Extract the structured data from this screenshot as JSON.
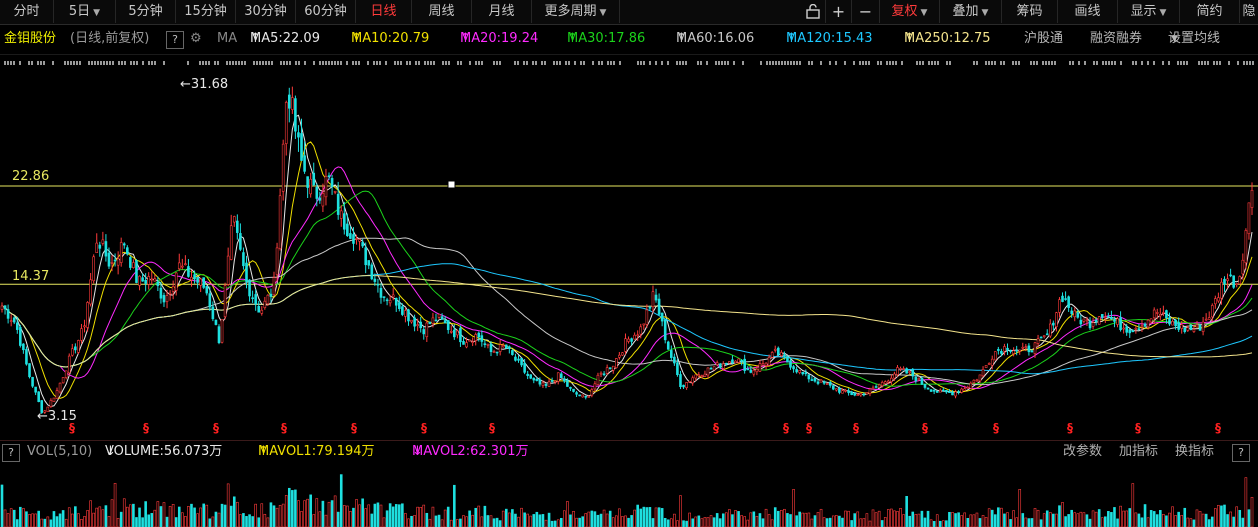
{
  "toolbar": {
    "periods": [
      "分时",
      "5日",
      "5分钟",
      "15分钟",
      "30分钟",
      "60分钟",
      "日线",
      "周线",
      "月线",
      "更多周期"
    ],
    "active_period": "日线",
    "tools": [
      "复权",
      "叠加",
      "筹码",
      "画线",
      "显示",
      "简约",
      "隐"
    ],
    "active_tool": "复权"
  },
  "ma_bar": {
    "stock_name": "金钼股份",
    "mode": "(日线,前复权)",
    "help": "?",
    "ma_label": "MA",
    "ma": [
      {
        "label": "MA5:22.09",
        "arrow": "↑",
        "color": "#e8e8e8"
      },
      {
        "label": "MA10:20.79",
        "arrow": "↑",
        "color": "#f0e000"
      },
      {
        "label": "MA20:19.24",
        "arrow": "↑",
        "color": "#ff2bff"
      },
      {
        "label": "MA30:17.86",
        "arrow": "↑",
        "color": "#1bd21b"
      },
      {
        "label": "MA60:16.06",
        "arrow": "↑",
        "color": "#c8c8c8"
      },
      {
        "label": "MA120:15.43",
        "arrow": "↑",
        "color": "#1ec8ff"
      },
      {
        "label": "MA250:12.75",
        "arrow": "↑",
        "color": "#f4e48c"
      }
    ],
    "links": [
      "沪股通",
      "融资融券",
      "设置均线"
    ]
  },
  "price_labels": {
    "high": "31.68",
    "low": "3.15",
    "line1": "22.86",
    "line2": "14.37"
  },
  "volume_bar": {
    "help": "?",
    "label": "VOL(5,10)",
    "volume": "VOLUME:56.073万",
    "volume_arrow": "↓",
    "mavol1": "MAVOL1:79.194万",
    "mavol1_arrow": "↑",
    "mavol2": "MAVOL2:62.301万",
    "mavol2_arrow": "↓",
    "actions": [
      "改参数",
      "加指标",
      "换指标"
    ]
  },
  "colors": {
    "up": "#ff3b3b",
    "down": "#1ee0e0",
    "ma5": "#e8e8e8",
    "ma10": "#f0e000",
    "ma20": "#ff2bff",
    "ma30": "#1bd21b",
    "ma60": "#c8c8c8",
    "ma120": "#1ec8ff",
    "ma250": "#f4e48c",
    "hline": "#e8e860"
  },
  "chart_data": {
    "type": "candlestick",
    "price_range": [
      3.15,
      31.68
    ],
    "horizontal_lines": [
      22.86,
      14.37
    ],
    "key_points": [
      {
        "label": "low",
        "value": 3.15
      },
      {
        "label": "high",
        "value": 31.68
      }
    ],
    "price_path_estimate": [
      12.5,
      11.0,
      6.5,
      3.15,
      5.0,
      8.0,
      10.5,
      18.5,
      16.0,
      18.0,
      14.5,
      15.0,
      13.0,
      16.0,
      15.0,
      14.0,
      9.5,
      20.0,
      14.5,
      12.0,
      14.0,
      31.68,
      25.0,
      22.0,
      23.5,
      20.0,
      18.5,
      16.0,
      13.5,
      13.0,
      11.5,
      10.5,
      11.5,
      10.5,
      9.5,
      10.0,
      8.5,
      9.0,
      7.5,
      6.0,
      5.5,
      6.5,
      5.0,
      4.5,
      6.5,
      7.5,
      9.5,
      10.5,
      13.5,
      9.0,
      5.5,
      6.5,
      7.0,
      7.5,
      8.0,
      6.8,
      7.5,
      8.5,
      7.5,
      6.5,
      6.0,
      5.5,
      5.0,
      4.8,
      5.2,
      6.0,
      7.0,
      6.5,
      5.5,
      5.0,
      5.0,
      5.5,
      6.5,
      8.5,
      9.0,
      8.5,
      9.0,
      10.0,
      13.5,
      11.5,
      11.0,
      12.0,
      11.0,
      10.5,
      11.0,
      12.0,
      11.0,
      10.5,
      10.5,
      12.0,
      15.0,
      14.5,
      22.86
    ],
    "sign_markers_count": 15,
    "sign_marker": "§"
  }
}
